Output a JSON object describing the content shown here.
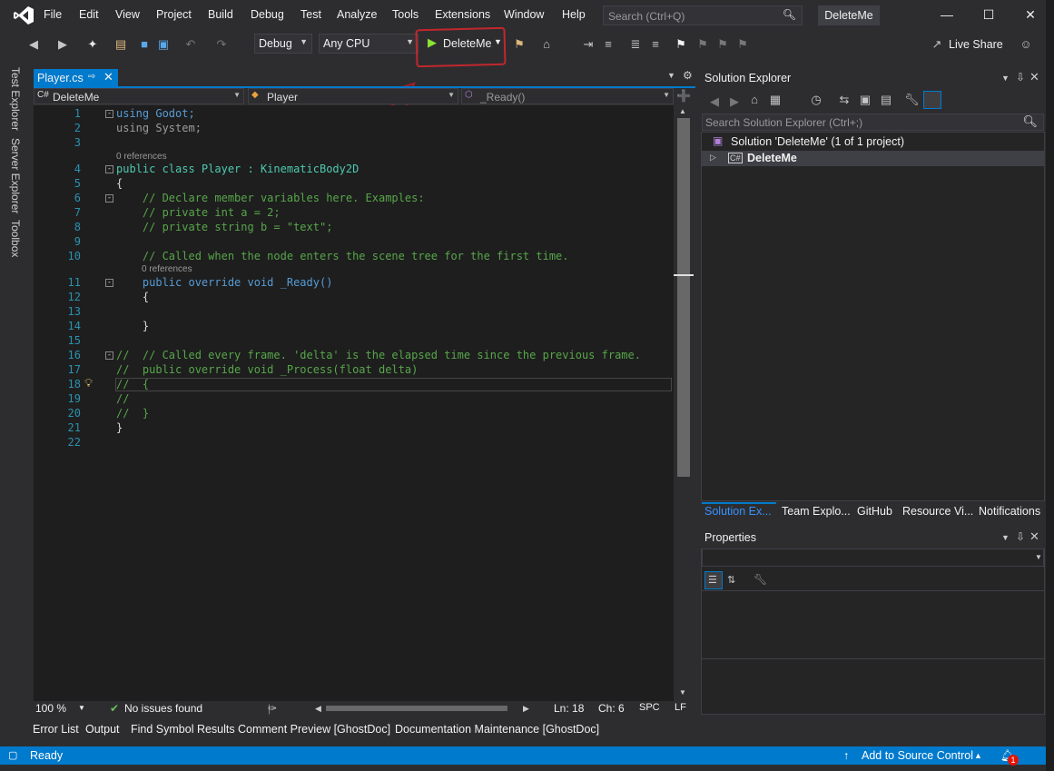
{
  "menu": {
    "items": [
      "File",
      "Edit",
      "View",
      "Project",
      "Build",
      "Debug",
      "Test",
      "Analyze",
      "Tools",
      "Extensions",
      "Window",
      "Help"
    ],
    "search_placeholder": "Search (Ctrl+Q)",
    "project_title": "DeleteMe"
  },
  "toolbar": {
    "config": "Debug",
    "platform": "Any CPU",
    "run_label": "DeleteMe",
    "live_share": "Live Share"
  },
  "side_tabs": [
    "Test Explorer",
    "Server Explorer",
    "Toolbox"
  ],
  "document_tab": {
    "name": "Player.cs"
  },
  "nav_bar": {
    "project": "DeleteMe",
    "class": "Player",
    "member": "_Ready()"
  },
  "editor": {
    "references_label": "0 references",
    "lines": [
      {
        "n": "1",
        "text": "using Godot;"
      },
      {
        "n": "2",
        "text": "using System;"
      },
      {
        "n": "3",
        "text": ""
      },
      {
        "n": "4",
        "text": "public class Player : KinematicBody2D"
      },
      {
        "n": "5",
        "text": "{"
      },
      {
        "n": "6",
        "text": "    // Declare member variables here. Examples:"
      },
      {
        "n": "7",
        "text": "    // private int a = 2;"
      },
      {
        "n": "8",
        "text": "    // private string b = \"text\";"
      },
      {
        "n": "9",
        "text": ""
      },
      {
        "n": "10",
        "text": "    // Called when the node enters the scene tree for the first time."
      },
      {
        "n": "11",
        "text": "    public override void _Ready()"
      },
      {
        "n": "12",
        "text": "    {"
      },
      {
        "n": "13",
        "text": ""
      },
      {
        "n": "14",
        "text": "    }"
      },
      {
        "n": "15",
        "text": ""
      },
      {
        "n": "16",
        "text": "//  // Called every frame. 'delta' is the elapsed time since the previous frame."
      },
      {
        "n": "17",
        "text": "//  public override void _Process(float delta)"
      },
      {
        "n": "18",
        "text": "//  {"
      },
      {
        "n": "19",
        "text": "//"
      },
      {
        "n": "20",
        "text": "//  }"
      },
      {
        "n": "21",
        "text": "}"
      },
      {
        "n": "22",
        "text": ""
      }
    ]
  },
  "editor_status": {
    "zoom": "100 %",
    "issues": "No issues found",
    "line": "Ln: 18",
    "col": "Ch: 6",
    "spc": "SPC",
    "eol": "LF"
  },
  "bottom_tabs": [
    "Error List",
    "Output",
    "Find Symbol Results",
    "Comment Preview [GhostDoc]",
    "Documentation Maintenance [GhostDoc]"
  ],
  "status_bar": {
    "state": "Ready",
    "source_control": "Add to Source Control",
    "notifications_count": "1"
  },
  "solution_explorer": {
    "title": "Solution Explorer",
    "search_placeholder": "Search Solution Explorer (Ctrl+;)",
    "solution": "Solution 'DeleteMe' (1 of 1 project)",
    "project": "DeleteMe",
    "tabs": [
      "Solution Ex...",
      "Team Explo...",
      "GitHub",
      "Resource Vi...",
      "Notifications"
    ]
  },
  "properties": {
    "title": "Properties"
  },
  "colors": {
    "accent": "#007acc",
    "annotation": "#c1272d"
  }
}
